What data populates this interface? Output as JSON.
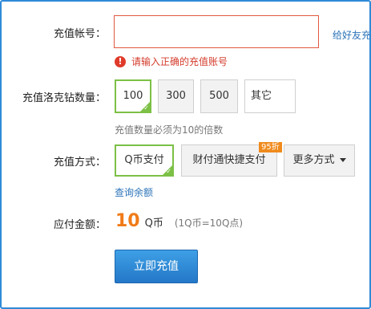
{
  "account": {
    "label": "充值帐号：",
    "value": "",
    "gift_link": "给好友充",
    "error_icon": "!",
    "error": "请输入正确的充值账号"
  },
  "quantity": {
    "label": "充值洛克钻数量：",
    "options": [
      "100",
      "300",
      "500",
      "其它"
    ],
    "selected": "100",
    "hint": "充值数量必须为10的倍数"
  },
  "payment": {
    "label": "充值方式：",
    "methods": [
      "Q币支付",
      "财付通快捷支付",
      "更多方式"
    ],
    "selected": "Q币支付",
    "discount_badge": "95折",
    "balance_link": "查询余额"
  },
  "total": {
    "label": "应付金额：",
    "amount": "10",
    "unit": "Q币",
    "rate": "(1Q币=10Q点)"
  },
  "submit_label": "立即充值",
  "colors": {
    "accent_blue": "#2f8ad8",
    "selected_green": "#7cc046",
    "error_red": "#d33b2b",
    "amount_orange": "#f07b18"
  }
}
